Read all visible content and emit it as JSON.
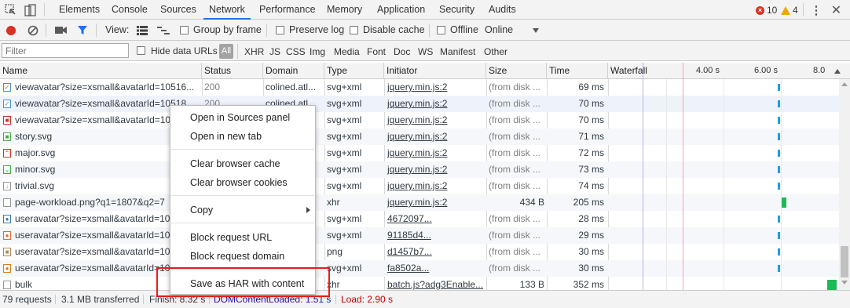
{
  "tabs": [
    "Elements",
    "Console",
    "Sources",
    "Network",
    "Performance",
    "Memory",
    "Application",
    "Security",
    "Audits"
  ],
  "active_tab": "Network",
  "counts": {
    "errors": "10",
    "warnings": "4"
  },
  "toolbar": {
    "view_label": "View:",
    "group_by_frame": "Group by frame",
    "preserve_log": "Preserve log",
    "disable_cache": "Disable cache",
    "offline": "Offline",
    "throttle": "Online"
  },
  "filter": {
    "placeholder": "Filter",
    "hide_data_urls": "Hide data URLs",
    "all": "All",
    "types": [
      "XHR",
      "JS",
      "CSS",
      "Img",
      "Media",
      "Font",
      "Doc",
      "WS",
      "Manifest",
      "Other"
    ]
  },
  "columns": {
    "name": "Name",
    "status": "Status",
    "domain": "Domain",
    "type": "Type",
    "initiator": "Initiator",
    "size": "Size",
    "time": "Time",
    "waterfall": "Waterfall"
  },
  "waterfall_ticks": [
    "4.00 s",
    "6.00 s",
    "8.0"
  ],
  "rows": [
    {
      "name": "viewavatar?size=xsmall&avatarId=10516...",
      "status": "200",
      "domain": "colined.atl...",
      "type": "svg+xml",
      "initiator": "jquery.min.js:2",
      "size": "(from disk ...",
      "time": "69 ms"
    },
    {
      "name": "viewavatar?size=xsmall&avatarId=10518...",
      "status": "200",
      "domain": "colined.atl...",
      "type": "svg+xml",
      "initiator": "jquery.min.js:2",
      "size": "(from disk ...",
      "time": "70 ms"
    },
    {
      "name": "viewavatar?size=xsmall&avatarId=10",
      "status": "",
      "domain": "",
      "type": "svg+xml",
      "initiator": "jquery.min.js:2",
      "size": "(from disk ...",
      "time": "70 ms"
    },
    {
      "name": "story.svg",
      "status": "",
      "domain": "",
      "type": "svg+xml",
      "initiator": "jquery.min.js:2",
      "size": "(from disk ...",
      "time": "71 ms"
    },
    {
      "name": "major.svg",
      "status": "",
      "domain": "",
      "type": "svg+xml",
      "initiator": "jquery.min.js:2",
      "size": "(from disk ...",
      "time": "72 ms"
    },
    {
      "name": "minor.svg",
      "status": "",
      "domain": "",
      "type": "svg+xml",
      "initiator": "jquery.min.js:2",
      "size": "(from disk ...",
      "time": "73 ms"
    },
    {
      "name": "trivial.svg",
      "status": "",
      "domain": "",
      "type": "svg+xml",
      "initiator": "jquery.min.js:2",
      "size": "(from disk ...",
      "time": "74 ms"
    },
    {
      "name": "page-workload.png?q1=1807&q2=7",
      "status": "",
      "domain": "",
      "type": "xhr",
      "initiator": "jquery.min.js:2",
      "size": "434 B",
      "time": "205 ms"
    },
    {
      "name": "useravatar?size=xsmall&avatarId=10",
      "status": "",
      "domain": "",
      "type": "svg+xml",
      "initiator": "4672097...",
      "size": "(from disk ...",
      "time": "28 ms"
    },
    {
      "name": "useravatar?size=xsmall&avatarId=10",
      "status": "",
      "domain": "",
      "type": "svg+xml",
      "initiator": "91185d4...",
      "size": "(from disk ...",
      "time": "29 ms"
    },
    {
      "name": "useravatar?size=xsmall&avatarId=10",
      "status": "",
      "domain": "",
      "type": "png",
      "initiator": "d1457b7...",
      "size": "(from disk ...",
      "time": "30 ms"
    },
    {
      "name": "useravatar?size=xsmall&avatarId=10",
      "status": "",
      "domain": "",
      "type": "svg+xml",
      "initiator": "fa8502a...",
      "size": "(from disk ...",
      "time": "30 ms"
    },
    {
      "name": "bulk",
      "status": "",
      "domain": "",
      "type": "xhr",
      "initiator": "batch.js?adg3Enable...",
      "size": "133 B",
      "time": "352 ms"
    }
  ],
  "context_menu": {
    "open_sources": "Open in Sources panel",
    "open_tab": "Open in new tab",
    "clear_cache": "Clear browser cache",
    "clear_cookies": "Clear browser cookies",
    "copy": "Copy",
    "block_url": "Block request URL",
    "block_domain": "Block request domain",
    "save_har": "Save as HAR with content"
  },
  "status": {
    "requests": "79 requests",
    "transferred": "3.1 MB transferred",
    "finish": "Finish: 8.32 s",
    "dcl": "DOMContentLoaded: 1.51 s",
    "load": "Load: 2.90 s"
  },
  "colors": {
    "accent": "#1a73e8",
    "record": "#d93025",
    "dcl": "#1a1aa6",
    "load": "#c80000",
    "highlight": "#e81c1c"
  }
}
